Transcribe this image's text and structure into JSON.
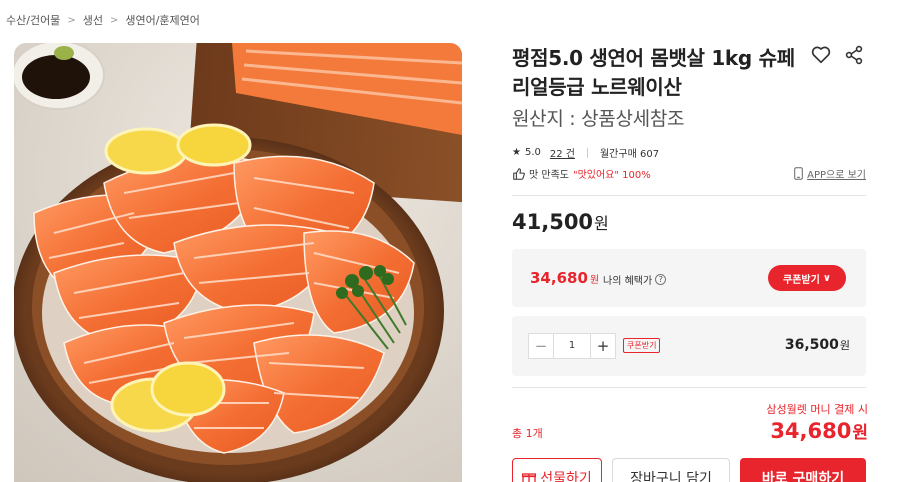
{
  "breadcrumb": [
    "수산/건어물",
    "생선",
    "생연어/훈제연어"
  ],
  "product": {
    "title": "평점5.0 생연어 몸뱃살 1kg 슈페리얼등급 노르웨이산",
    "origin": "원산지 : 상품상세참조",
    "rating_star": "★",
    "rating_value": "5.0",
    "review_count": "22 건",
    "monthly_sales": "월간구매 607",
    "satisfaction_label": "맛 만족도",
    "satisfaction_quote": "\"맛있어요\" 100%",
    "app_link": "APP으로 보기",
    "price": "41,500",
    "won": "원"
  },
  "benefit": {
    "price": "34,680",
    "won": "원",
    "label": "나의 혜택가",
    "info_glyph": "?",
    "coupon_button": "쿠폰받기",
    "chevron": "∨"
  },
  "order": {
    "minus": "−",
    "quantity": "1",
    "plus": "+",
    "coupon_tag": "쿠폰받기",
    "line_price": "36,500",
    "won": "원"
  },
  "summary": {
    "pay_label": "삼성월렛 머니 결제 시",
    "total_count": "총 1개",
    "total_price": "34,680",
    "won": "원"
  },
  "actions": {
    "gift": "선물하기",
    "cart": "장바구니 담기",
    "buy": "바로 구매하기"
  },
  "colors": {
    "accent": "#e8242c",
    "panel": "#f5f5f5"
  },
  "icons": [
    "heart-icon",
    "share-icon",
    "thumb-up-icon",
    "phone-icon",
    "gift-icon",
    "info-icon",
    "chevron-right-icon"
  ]
}
